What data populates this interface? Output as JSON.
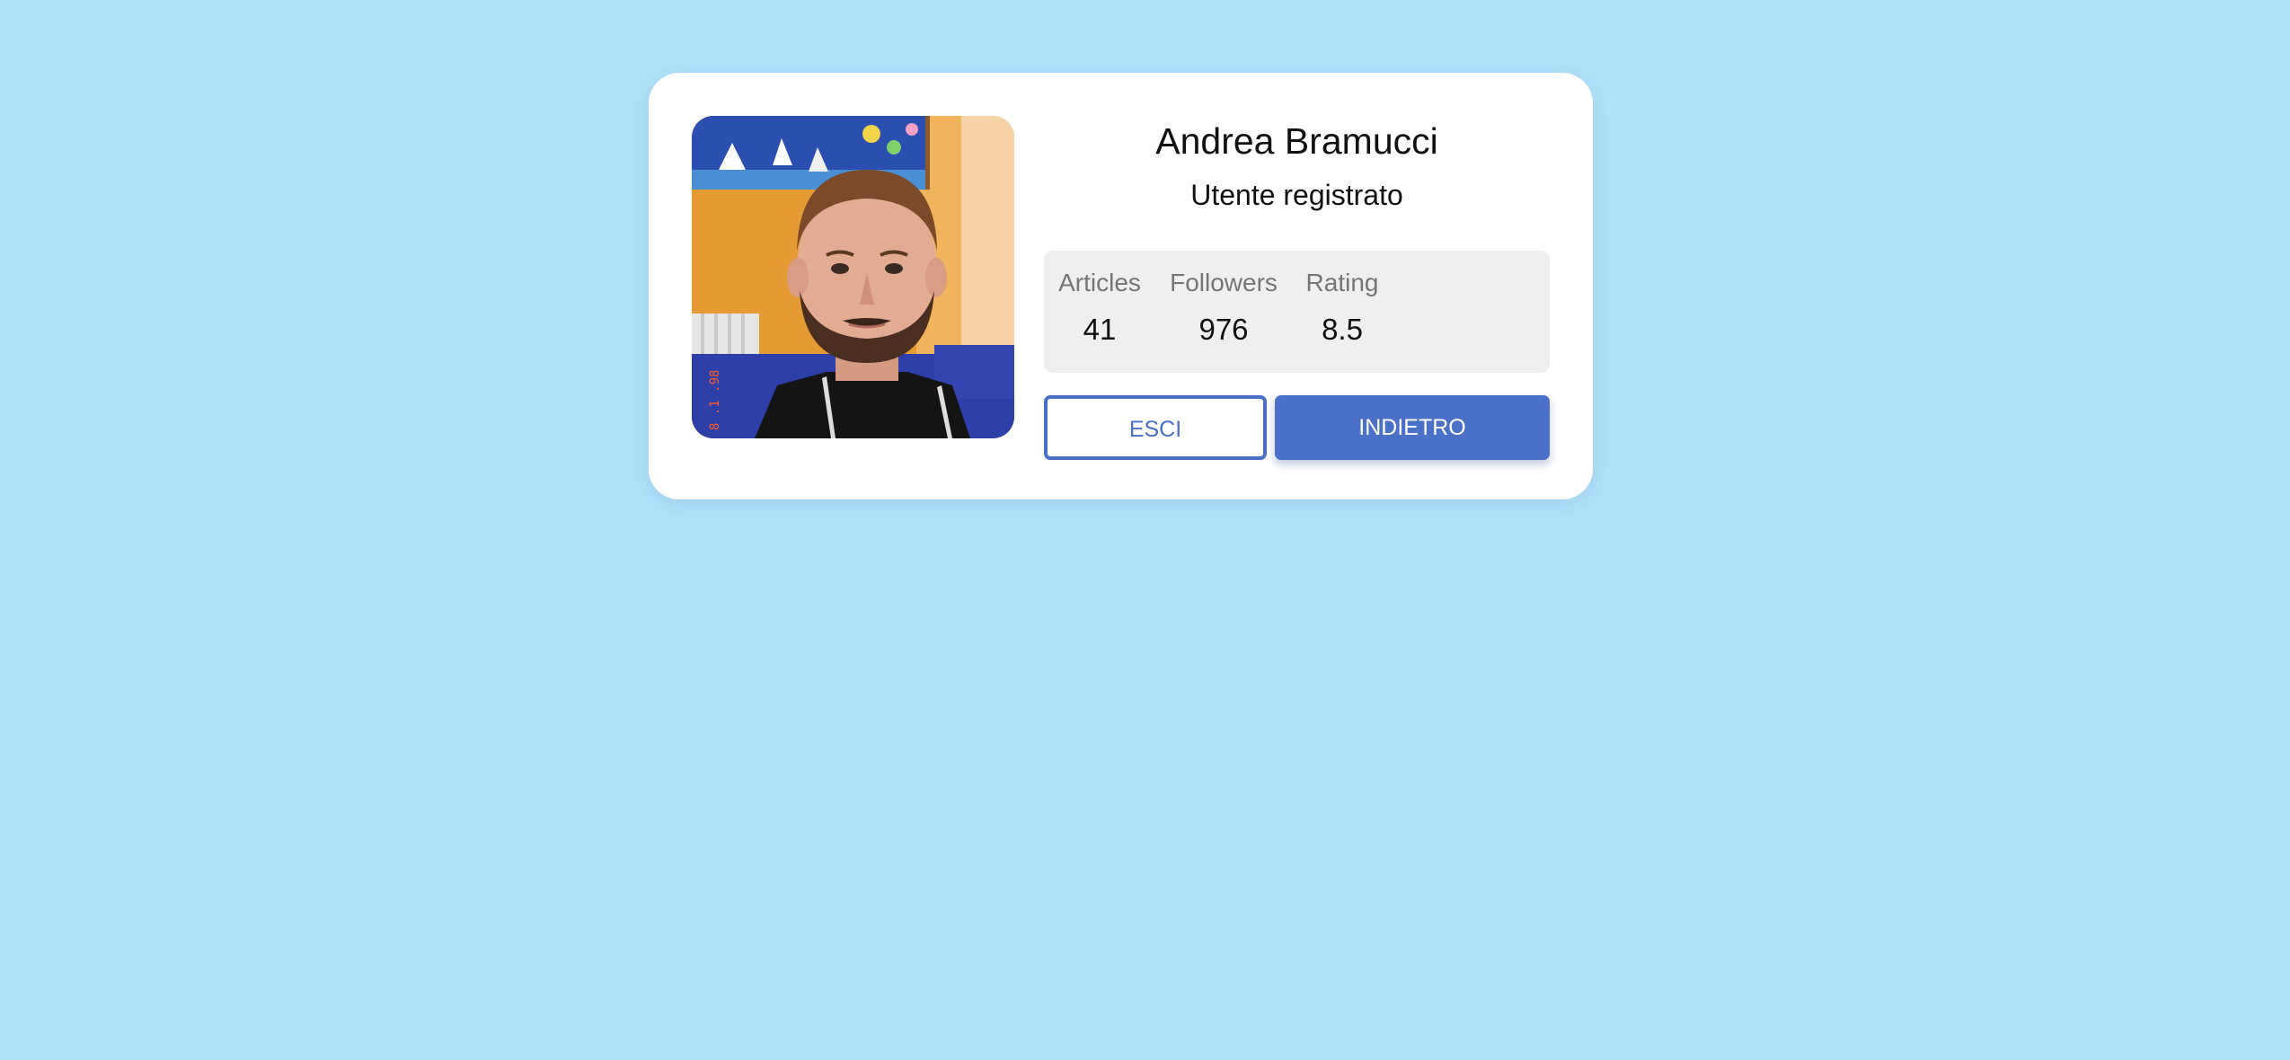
{
  "profile": {
    "name": "Andrea Bramucci",
    "role": "Utente registrato",
    "photo_stamp": "8 .1 .98"
  },
  "stats": [
    {
      "label": "Articles",
      "value": "41"
    },
    {
      "label": "Followers",
      "value": "976"
    },
    {
      "label": "Rating",
      "value": "8.5"
    }
  ],
  "buttons": {
    "exit_label": "ESCI",
    "back_label": "INDIETRO"
  },
  "colors": {
    "background": "#b0e0fa",
    "card": "#ffffff",
    "accent": "#4a70c8",
    "stats_panel": "#efefef"
  }
}
